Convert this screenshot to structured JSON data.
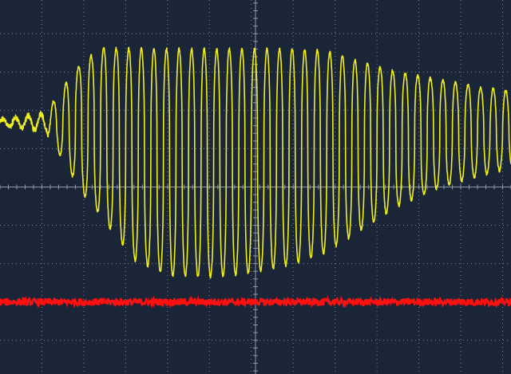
{
  "colors": {
    "background": "#1b2538",
    "grid": "#8e99ad",
    "channel_1": "#f0ee1a",
    "channel_2": "#ff1010"
  },
  "chart_data": {
    "type": "line",
    "title": "",
    "xlabel": "",
    "ylabel": "",
    "xlim": [
      0,
      12.2
    ],
    "ylim": [
      -4.88,
      4.88
    ],
    "grid": true,
    "divisions": {
      "x": 12.2,
      "y": 9.77
    },
    "center_axes": {
      "x": 0,
      "y": 0
    },
    "legend": "none",
    "series": [
      {
        "color": "#f0ee1a",
        "kind": "burst",
        "baseline": 1.7,
        "oscillation_period_div": 0.3,
        "envelope": {
          "x": [
            0.0,
            1.1,
            1.5,
            2.0,
            2.5,
            3.2,
            4.0,
            5.0,
            6.0,
            7.0,
            7.8,
            8.5,
            9.5,
            10.5,
            11.5,
            12.2
          ],
          "upper": [
            1.75,
            1.95,
            2.6,
            3.3,
            3.65,
            3.6,
            3.6,
            3.6,
            3.6,
            3.6,
            3.55,
            3.3,
            3.0,
            2.8,
            2.6,
            2.5
          ],
          "lower": [
            1.6,
            1.45,
            0.7,
            -0.2,
            -0.9,
            -1.9,
            -2.3,
            -2.35,
            -2.25,
            -2.0,
            -1.7,
            -1.2,
            -0.5,
            0.0,
            0.3,
            0.5
          ]
        }
      },
      {
        "color": "#ff1010",
        "kind": "flat_noise",
        "level": -3.0,
        "noise_amplitude": 0.1
      }
    ]
  }
}
